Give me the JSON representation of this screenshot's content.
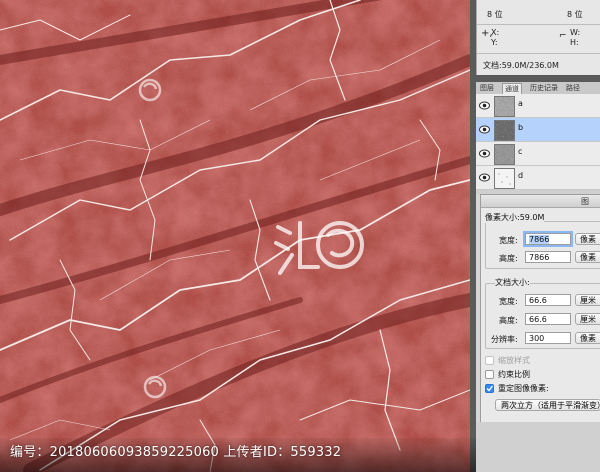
{
  "watermark": {
    "caption": "编号：20180606093859225060 上传者ID：559332"
  },
  "info_panel": {
    "bits_left": "8 位",
    "bits_right": "8 位",
    "x_label": "X:",
    "y_label": "Y:",
    "w_label": "W:",
    "h_label": "H:",
    "doc_size": "文档:59.0M/236.0M"
  },
  "panel_tabs": [
    "图层",
    "通道",
    "历史记录",
    "路径"
  ],
  "active_tab": 1,
  "channels": [
    {
      "name": "a"
    },
    {
      "name": "b",
      "selected": true
    },
    {
      "name": "c"
    },
    {
      "name": "d"
    }
  ],
  "dialog": {
    "title": "图",
    "pixel_group_title": "像素大小:59.0M",
    "pixel_width_label": "宽度:",
    "pixel_width_value": "7866",
    "pixel_width_unit": "像素",
    "pixel_height_label": "高度:",
    "pixel_height_value": "7866",
    "pixel_height_unit": "像素",
    "doc_group_title": "文档大小:",
    "doc_width_label": "宽度:",
    "doc_width_value": "66.6",
    "doc_width_unit": "厘米",
    "doc_height_label": "高度:",
    "doc_height_value": "66.6",
    "doc_height_unit": "厘米",
    "resolution_label": "分辨率:",
    "resolution_value": "300",
    "resolution_unit": "像素",
    "scale_styles_label": "缩放样式",
    "constrain_label": "约束比例",
    "resample_label": "重定图像像素:",
    "resample_method": "两次立方（适用于平滑渐变）"
  },
  "colors": {
    "marble_base": "#a8403a",
    "selection_blue": "#b4d2fb",
    "checkbox_blue": "#3a86f7"
  }
}
